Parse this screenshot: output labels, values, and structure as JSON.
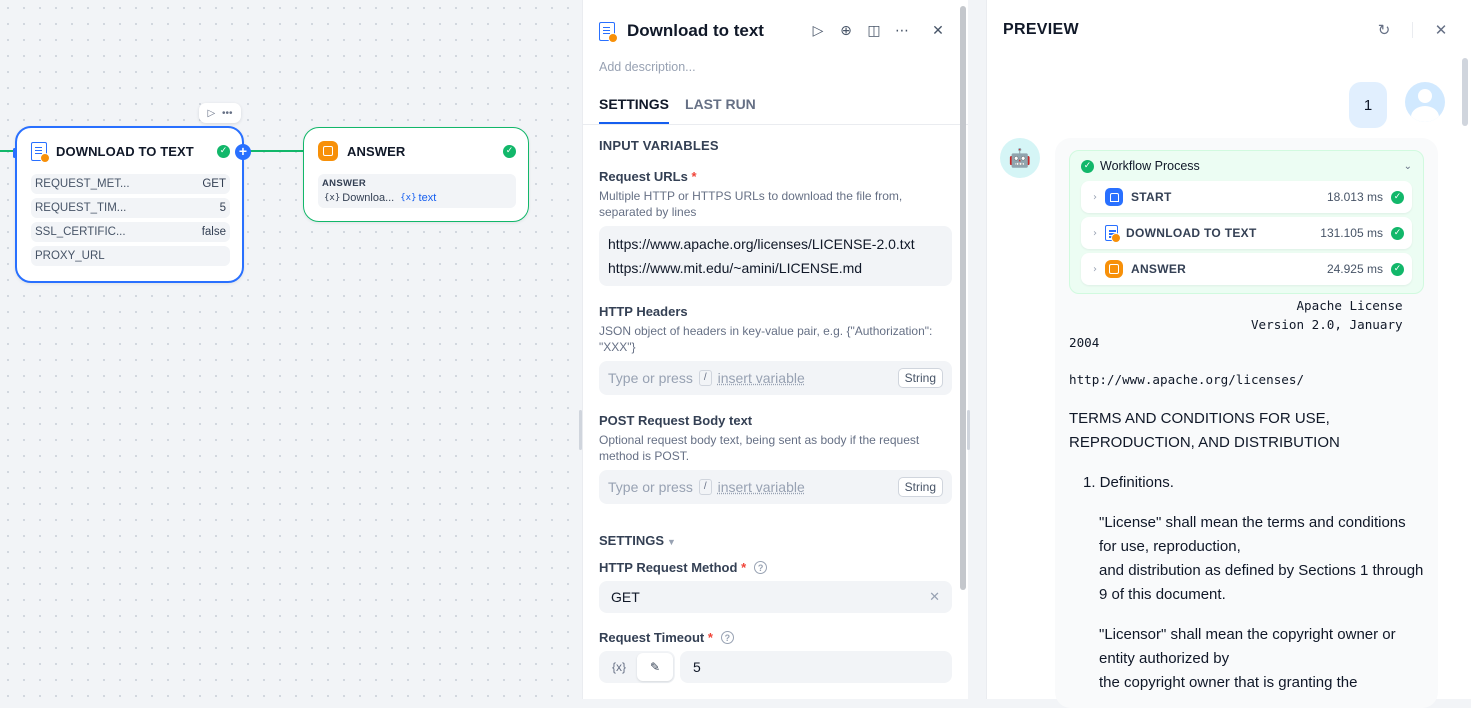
{
  "canvas": {
    "download_node": {
      "title": "DOWNLOAD TO TEXT",
      "params": [
        {
          "name": "REQUEST_MET...",
          "value": "GET"
        },
        {
          "name": "REQUEST_TIM...",
          "value": "5"
        },
        {
          "name": "SSL_CERTIFIC...",
          "value": "false"
        },
        {
          "name": "PROXY_URL",
          "value": ""
        }
      ]
    },
    "answer_node": {
      "title": "ANSWER",
      "var_label": "ANSWER",
      "var_source": "Downloa...",
      "var_field": "text"
    }
  },
  "panel": {
    "title": "Download to text",
    "description_placeholder": "Add description...",
    "tabs": [
      "SETTINGS",
      "LAST RUN"
    ],
    "input_variables_title": "INPUT VARIABLES",
    "request_urls": {
      "label": "Request URLs",
      "required": "*",
      "help": "Multiple HTTP or HTTPS URLs to download the file from, separated by lines",
      "lines": [
        "https://www.apache.org/licenses/LICENSE-2.0.txt",
        "https://www.mit.edu/~amini/LICENSE.md"
      ]
    },
    "http_headers": {
      "label": "HTTP Headers",
      "help": "JSON object of headers in key-value pair, e.g. {\"Authorization\": \"XXX\"}",
      "placeholder": "Type or press",
      "slash": "/",
      "insert": "insert variable",
      "type": "String"
    },
    "post_body": {
      "label": "POST Request Body text",
      "help": "Optional request body text, being sent as body if the request method is POST.",
      "placeholder": "Type or press",
      "slash": "/",
      "insert": "insert variable",
      "type": "String"
    },
    "settings_title": "SETTINGS",
    "method": {
      "label": "HTTP Request Method",
      "required": "*",
      "value": "GET"
    },
    "timeout": {
      "label": "Request Timeout",
      "required": "*",
      "value": "5"
    }
  },
  "preview": {
    "title": "PREVIEW",
    "user_message": "1",
    "workflow": {
      "title": "Workflow Process",
      "steps": [
        {
          "name": "START",
          "time": "18.013 ms"
        },
        {
          "name": "DOWNLOAD TO TEXT",
          "time": "131.105 ms"
        },
        {
          "name": "ANSWER",
          "time": "24.925 ms"
        }
      ]
    },
    "mono_lines": [
      "                              Apache License",
      "                        Version 2.0, January",
      "2004"
    ],
    "mono_url": "http://www.apache.org/licenses/",
    "terms": "TERMS AND CONDITIONS FOR USE, REPRODUCTION, AND DISTRIBUTION",
    "list_item": "1. Definitions.",
    "def_license": "\"License\" shall mean the terms and conditions for use, reproduction,",
    "def_license_2": "and distribution as defined by Sections 1 through 9 of this document.",
    "def_licensor": "\"Licensor\" shall mean the copyright owner or entity authorized by",
    "def_licensor_2": "the copyright owner that is granting the"
  }
}
